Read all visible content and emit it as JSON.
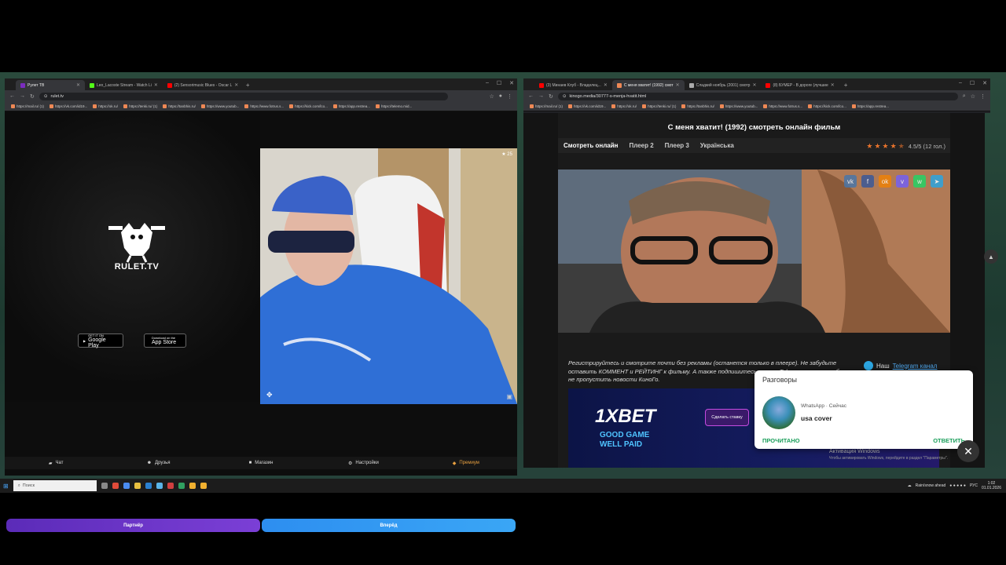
{
  "left_browser": {
    "tabs": [
      {
        "label": "Рулет ТВ",
        "active": true,
        "color": "#7b2cbf"
      },
      {
        "label": "Leo_Lacoste Stream - Watch Li",
        "active": false,
        "color": "#53fc18"
      },
      {
        "label": "(2) Sensorimusic Blues - Oscar L",
        "active": false,
        "color": "#ff0000"
      }
    ],
    "url": "rulet.tv",
    "bookmarks": [
      "https://mail.ru/ (1)",
      "https://vk.com/id19...",
      "https://ok.ru/",
      "https://tenki.ru/ (1)",
      "https://tanbhis.ru/",
      "https://www.youtub...",
      "https://www.fotrus.s...",
      "https://kick.com/lco...",
      "https://app.restrea...",
      "https://telemo.mid..."
    ]
  },
  "rulet": {
    "logo_text": "RULET.TV",
    "google_play_top": "GET IT ON",
    "google_play": "Google Play",
    "app_store_top": "Download on the",
    "app_store": "App Store",
    "video_badge": "★ 25",
    "partner_btn_left": "Партнёр",
    "partner_btn_right": "Вперёд",
    "nav": [
      {
        "icon": "chat-icon",
        "label": "Чат"
      },
      {
        "icon": "friends-icon",
        "label": "Друзья"
      },
      {
        "icon": "shop-icon",
        "label": "Магазин"
      },
      {
        "icon": "gear-icon",
        "label": "Настройки"
      },
      {
        "icon": "premium-icon",
        "label": "Премиум"
      }
    ]
  },
  "right_browser": {
    "tabs": [
      {
        "label": "(3) Минаев Клуб - Владелец...",
        "active": false,
        "color": "#ff0000"
      },
      {
        "label": "С меня хватит! (1992) смот",
        "active": true,
        "color": "#e85"
      },
      {
        "label": "Сладкий ноябрь (2001) смотр",
        "active": false,
        "color": "#aaa"
      },
      {
        "label": "(8) БУМЕР - В дороге (лучшие",
        "active": false,
        "color": "#ff0000"
      }
    ],
    "url": "kinogo.media/30777-s-menja-hvatit.html",
    "bookmarks": [
      "https://mail.ru/ (1)",
      "https://vk.com/id19...",
      "https://ok.ru/",
      "https://tenki.ru/ (1)",
      "https://tanbhis.ru/",
      "https://www.youtub...",
      "https://www.fotrus.s...",
      "https://kick.com/lco...",
      "https://app.restrea..."
    ]
  },
  "kinogo": {
    "title": "С меня хватит! (1992) смотреть онлайн фильм",
    "player_tabs": [
      "Смотреть онлайн",
      "Плеер 2",
      "Плеер 3",
      "Українська"
    ],
    "stars": 4.5,
    "rating_text": "4.5/5 (12 гол.)",
    "share_icons": [
      {
        "icon": "vk-icon",
        "glyph": "vk",
        "color": "#4a76a8"
      },
      {
        "icon": "facebook-icon",
        "glyph": "f",
        "color": "#3b5998"
      },
      {
        "icon": "odnoklassniki-icon",
        "glyph": "ok",
        "color": "#ee8208"
      },
      {
        "icon": "viber-icon",
        "glyph": "v",
        "color": "#7360f2"
      },
      {
        "icon": "whatsapp-icon",
        "glyph": "w",
        "color": "#25d366"
      },
      {
        "icon": "telegram-icon",
        "glyph": "➤",
        "color": "#2ca5e0"
      }
    ],
    "notice": "Регистрируйтесь и смотрите почти без рекламы (останется только в плеере). Не забудьте оставить КОММЕНТ и РЕЙТИНГ к фильму. А также подпишитесь на наш Telegram канал, чтобы не пропустить новости КиноГо.",
    "tg_prefix": "Наш",
    "tg_link": "Telegram канал",
    "ad_brand": "1XBET",
    "ad_slogan1": "GOOD GAME",
    "ad_slogan2": "WELL PAID",
    "ad_button": "Сделать ставку"
  },
  "notification": {
    "header": "Разговоры",
    "source": "WhatsApp · Сейчас",
    "message": "usa cover",
    "action_read": "ПРОЧИТАНО",
    "action_reply": "ОТВЕТИТЬ"
  },
  "windows_activation": {
    "title": "Активация Windows",
    "subtitle": "Чтобы активировать Windows, перейдите в раздел \"Параметры\"."
  },
  "taskbar": {
    "search_placeholder": "Поиск",
    "weather": "Rain/snow ahead",
    "lang": "РУС",
    "time": "1:02",
    "date": "01.01.2026"
  }
}
